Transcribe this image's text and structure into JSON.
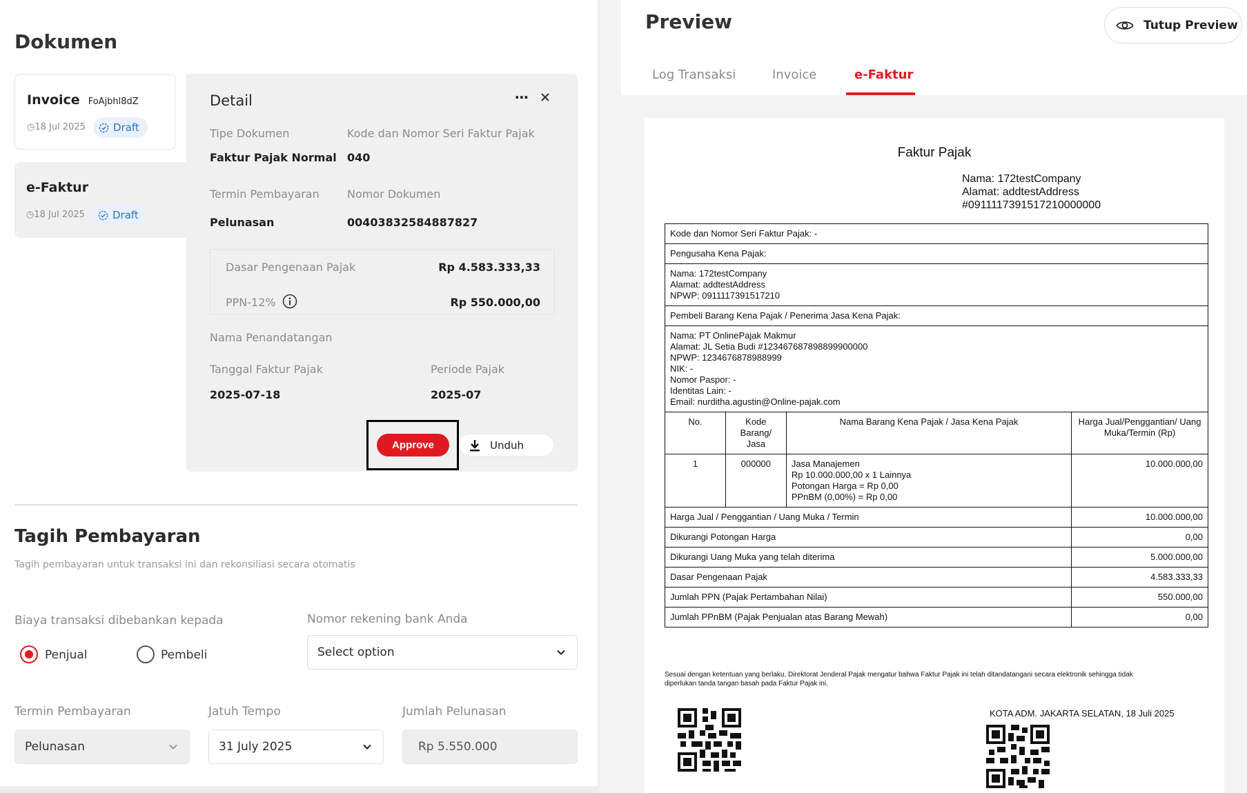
{
  "left": {
    "title": "Dokumen",
    "documents": [
      {
        "name": "Invoice",
        "id": "FoAjbhl8dZ",
        "date": "18 Jul 2025",
        "status": "Draft"
      },
      {
        "name": "e-Faktur",
        "id": "",
        "date": "18 Jul 2025",
        "status": "Draft"
      }
    ],
    "detail": {
      "title": "Detail",
      "more_icon": "ellipsis-icon",
      "close_icon": "close-icon",
      "tipe_label": "Tipe Dokumen",
      "tipe_value": "Faktur Pajak Normal",
      "kode_label": "Kode dan Nomor Seri Faktur Pajak",
      "kode_value": "040",
      "termin_label": "Termin Pembayaran",
      "termin_value": "Pelunasan",
      "nomor_label": "Nomor Dokumen",
      "nomor_value": "00403832584887827",
      "dpp_label": "Dasar Pengenaan Pajak",
      "dpp_value": "Rp 4.583.333,33",
      "ppn_label": "PPN-12%",
      "ppn_value": "Rp 550.000,00",
      "penandatangan_label": "Nama Penandatangan",
      "tanggal_label": "Tanggal Faktur Pajak",
      "tanggal_value": "2025-07-18",
      "periode_label": "Periode Pajak",
      "periode_value": "2025-07",
      "approve_label": "Approve",
      "unduh_label": "Unduh"
    },
    "tagih": {
      "title": "Tagih Pembayaran",
      "subtitle": "Tagih pembayaran untuk transaksi ini dan rekonsiliasi secara otomatis",
      "biaya_label": "Biaya transaksi dibebankan kepada",
      "radio_penjual": "Penjual",
      "radio_pembeli": "Pembeli",
      "rekening_label": "Nomor rekening bank Anda",
      "rekening_value": "Select option",
      "termin_label": "Termin Pembayaran",
      "termin_value": "Pelunasan",
      "jatuh_label": "Jatuh Tempo",
      "jatuh_value": "31 July 2025",
      "jumlah_label": "Jumlah Pelunasan",
      "jumlah_value": "Rp 5.550.000"
    }
  },
  "right": {
    "title": "Preview",
    "tutup_label": "Tutup Preview",
    "tabs": [
      "Log Transaksi",
      "Invoice",
      "e-Faktur"
    ],
    "active_tab": "e-Faktur",
    "accent": "#e11a22"
  },
  "faktur": {
    "title": "Faktur Pajak",
    "head_nama": "Nama: 172testCompany",
    "head_alamat": "Alamat: addtestAddress",
    "head_id": "#0911117391517210000000",
    "row_kode": "Kode dan Nomor Seri Faktur Pajak: -",
    "row_pkp": "Pengusaha Kena Pajak:",
    "pkp_nama": "Nama: 172testCompany",
    "pkp_alamat": "Alamat: addtestAddress",
    "pkp_npwp": "NPWP: 0911117391517210",
    "row_pembeli": "Pembeli Barang Kena Pajak / Penerima Jasa Kena Pajak:",
    "pb_nama": "Nama: PT OnlinePajak Makmur",
    "pb_alamat": "Alamat: JL Setia Budi #123467687898899900000",
    "pb_npwp": "NPWP: 1234676878988999",
    "pb_nik": "NIK: -",
    "pb_paspor": "Nomor Paspor: -",
    "pb_identitas": "Identitas Lain: -",
    "pb_email": "Email: nurditha.agustin@Online-pajak.com",
    "col_no": "No.",
    "col_kode": "Kode Barang/ Jasa",
    "col_nama": "Nama Barang Kena Pajak / Jasa Kena Pajak",
    "col_harga": "Harga Jual/Penggantian/ Uang Muka/Termin (Rp)",
    "item_no": "1",
    "item_kode": "000000",
    "item_l1": "Jasa Manajemen",
    "item_l2": "Rp 10.000.000,00 x 1 Lainnya",
    "item_l3": "Potongan Harga = Rp 0,00",
    "item_l4": "PPnBM (0,00%) = Rp 0,00",
    "item_harga": "10.000.000,00",
    "summary": [
      {
        "label": "Harga Jual / Penggantian / Uang Muka / Termin",
        "value": "10.000.000,00"
      },
      {
        "label": "Dikurangi Potongan Harga",
        "value": "0,00"
      },
      {
        "label": "Dikurangi Uang Muka yang telah diterima",
        "value": "5.000.000,00"
      },
      {
        "label": "Dasar Pengenaan Pajak",
        "value": "4.583.333,33"
      },
      {
        "label": "Jumlah PPN (Pajak Pertambahan Nilai)",
        "value": "550.000,00"
      },
      {
        "label": "Jumlah PPnBM (Pajak Penjualan atas Barang Mewah)",
        "value": "0,00"
      }
    ],
    "note": "Sesuai dengan ketentuan yang berlaku, Direktorat Jenderal Pajak mengatur bahwa Faktur Pajak ini telah ditandatangani secara elektronik sehingga tidak diperlukan tanda tangan basah pada Faktur Pajak ini.",
    "sign_city": "KOTA ADM. JAKARTA SELATAN, 18 Juli 2025"
  }
}
